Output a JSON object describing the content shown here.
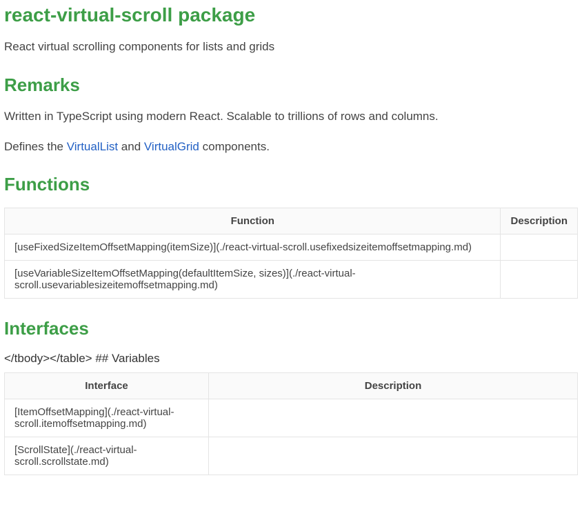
{
  "title": "react-virtual-scroll package",
  "intro": "React virtual scrolling components for lists and grids",
  "remarks": {
    "heading": "Remarks",
    "p1": "Written in TypeScript using modern React. Scalable to trillions of rows and columns.",
    "defines_prefix": "Defines the ",
    "link1": "VirtualList",
    "and": " and ",
    "link2": "VirtualGrid",
    "suffix": " components."
  },
  "functions": {
    "heading": "Functions",
    "cols": {
      "func": "Function",
      "desc": "Description"
    },
    "rows": [
      {
        "func": "[useFixedSizeItemOffsetMapping(itemSize)](./react-virtual-scroll.usefixedsizeitemoffsetmapping.md)",
        "desc": ""
      },
      {
        "func": "[useVariableSizeItemOffsetMapping(defaultItemSize, sizes)](./react-virtual-scroll.usevariablesizeitemoffsetmapping.md)",
        "desc": ""
      }
    ]
  },
  "interfaces": {
    "heading": "Interfaces",
    "stray_text": "</tbody></table> ## Variables",
    "cols": {
      "iface": "Interface",
      "desc": "Description"
    },
    "rows": [
      {
        "iface": "[ItemOffsetMapping](./react-virtual-scroll.itemoffsetmapping.md)",
        "desc": ""
      },
      {
        "iface": "[ScrollState](./react-virtual-scroll.scrollstate.md)",
        "desc": ""
      }
    ]
  }
}
